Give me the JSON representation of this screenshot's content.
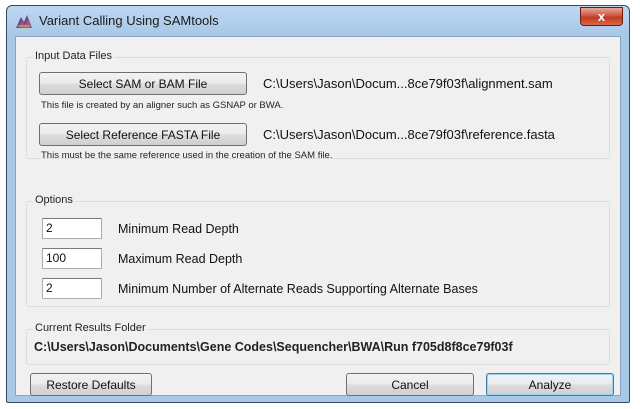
{
  "window": {
    "title": "Variant Calling Using SAMtools",
    "close_glyph": "x"
  },
  "input_files": {
    "legend": "Input Data Files",
    "sam": {
      "button_label": "Select SAM or BAM File",
      "path": "C:\\Users\\Jason\\Docum...8ce79f03f\\alignment.sam",
      "hint": "This file is created by an aligner such as GSNAP or BWA."
    },
    "fasta": {
      "button_label": "Select Reference FASTA File",
      "path": "C:\\Users\\Jason\\Docum...8ce79f03f\\reference.fasta",
      "hint": "This must be the same reference used in the creation of the SAM file."
    }
  },
  "options": {
    "legend": "Options",
    "fields": [
      {
        "value": "2",
        "label": "Minimum Read Depth"
      },
      {
        "value": "100",
        "label": "Maximum Read Depth"
      },
      {
        "value": "2",
        "label": "Minimum Number of Alternate Reads Supporting Alternate Bases"
      }
    ]
  },
  "results": {
    "legend": "Current Results Folder",
    "path": "C:\\Users\\Jason\\Documents\\Gene Codes\\Sequencher\\BWA\\Run f705d8f8ce79f03f"
  },
  "buttons": {
    "restore": "Restore Defaults",
    "cancel": "Cancel",
    "analyze": "Analyze"
  },
  "icons": {
    "app": "dna-mountain-icon",
    "close": "close-icon"
  }
}
